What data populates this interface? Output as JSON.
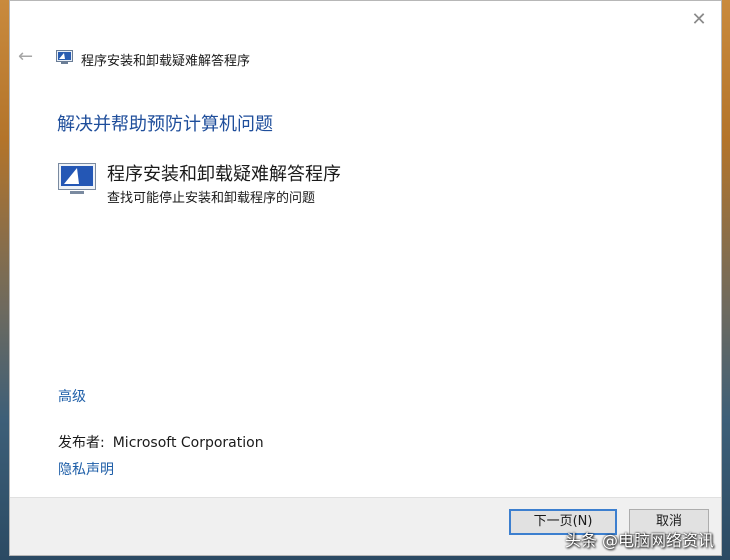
{
  "window": {
    "title": "程序安装和卸载疑难解答程序",
    "close_glyph": "✕",
    "back_glyph": "←"
  },
  "main": {
    "heading": "解决并帮助预防计算机问题",
    "item": {
      "title": "程序安装和卸载疑难解答程序",
      "description": "查找可能停止安装和卸载程序的问题"
    },
    "advanced_link": "高级",
    "publisher_label": "发布者:",
    "publisher_value": "Microsoft Corporation",
    "privacy_link": "隐私声明"
  },
  "footer": {
    "next_label": "下一页(N)",
    "cancel_label": "取消"
  },
  "watermark": "头条 @电脑网络资讯",
  "colors": {
    "heading": "#1f4e9b",
    "link": "#1f5fa8",
    "primary_border": "#3c7fcf"
  },
  "icons": {
    "back": "arrow-left-icon",
    "close": "close-icon",
    "title": "troubleshooter-icon",
    "item": "troubleshooter-icon"
  }
}
